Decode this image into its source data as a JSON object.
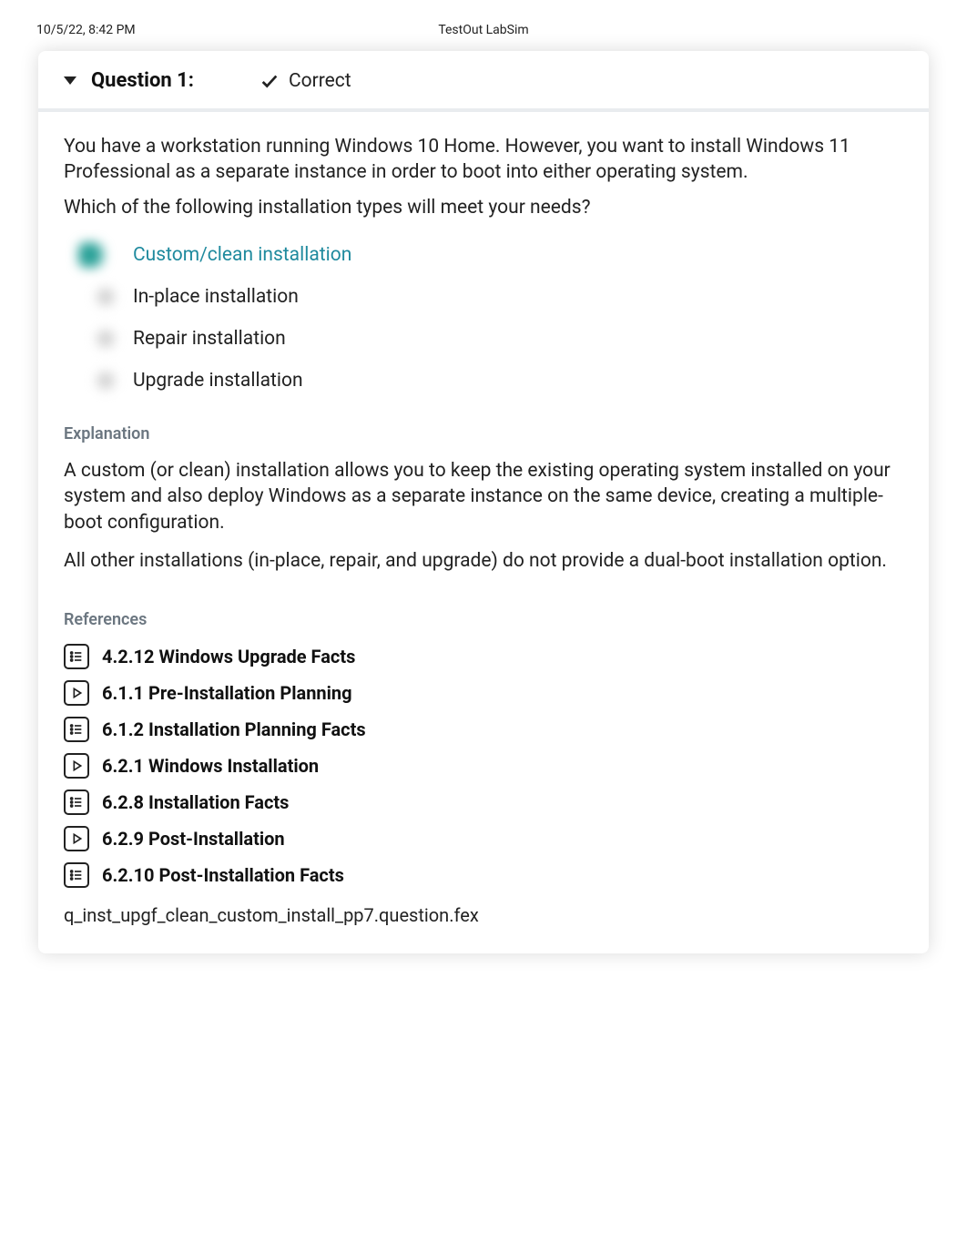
{
  "meta": {
    "timestamp": "10/5/22, 8:42 PM",
    "app": "TestOut LabSim"
  },
  "question": {
    "label": "Question 1:",
    "status": "Correct",
    "stem_p1": "You have a workstation running Windows 10 Home. However, you want to install Windows 11 Professional as a separate instance in order to boot into either operating system.",
    "stem_p2": "Which of the following installation types will meet your needs?",
    "options": [
      {
        "text": "Custom/clean installation",
        "correct": true
      },
      {
        "text": "In-place installation",
        "correct": false
      },
      {
        "text": "Repair installation",
        "correct": false
      },
      {
        "text": "Upgrade installation",
        "correct": false
      }
    ]
  },
  "explanation": {
    "heading": "Explanation",
    "p1": "A custom (or clean) installation allows you to keep the existing operating system installed on your system and also deploy Windows as a separate instance on the same device, creating a multiple-boot configuration.",
    "p2": "All other installations (in-place, repair, and upgrade) do not provide a dual-boot installation option."
  },
  "references": {
    "heading": "References",
    "items": [
      {
        "icon": "list",
        "label": "4.2.12 Windows Upgrade Facts"
      },
      {
        "icon": "play",
        "label": "6.1.1 Pre-Installation Planning"
      },
      {
        "icon": "list",
        "label": "6.1.2 Installation Planning Facts"
      },
      {
        "icon": "play",
        "label": "6.2.1 Windows Installation"
      },
      {
        "icon": "list",
        "label": "6.2.8 Installation Facts"
      },
      {
        "icon": "play",
        "label": "6.2.9 Post-Installation"
      },
      {
        "icon": "list",
        "label": "6.2.10 Post-Installation Facts"
      }
    ]
  },
  "question_id": "q_inst_upgf_clean_custom_install_pp7.question.fex"
}
